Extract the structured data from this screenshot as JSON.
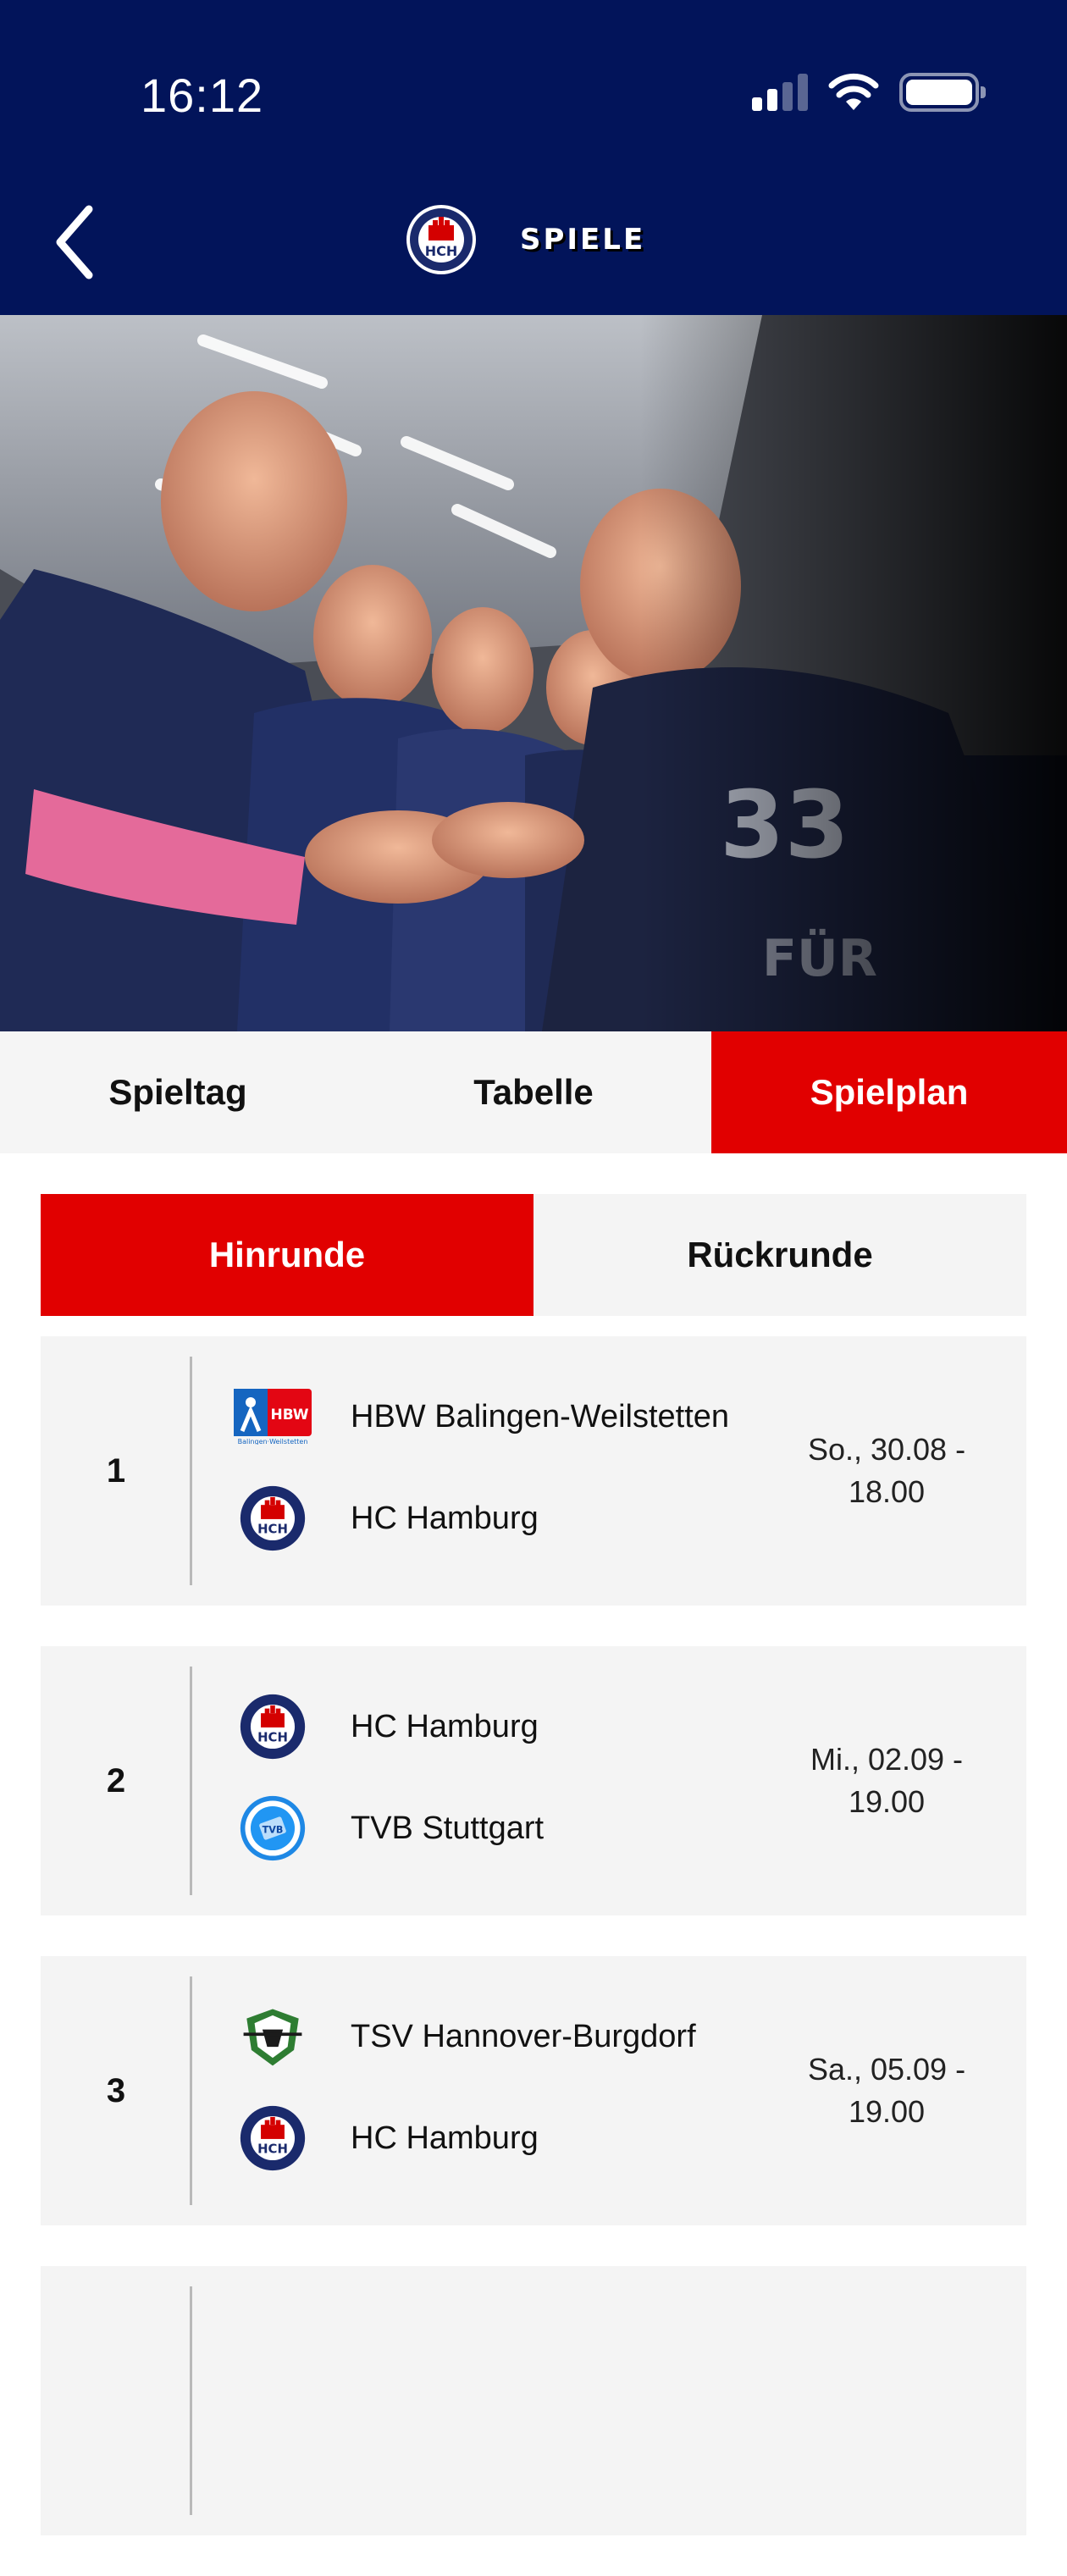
{
  "status_bar": {
    "time": "16:12"
  },
  "header": {
    "title": "SPIELE",
    "back_icon": "chevron-left-icon",
    "logo_text": "HCH"
  },
  "main_tabs": [
    {
      "label": "Spieltag",
      "active": false
    },
    {
      "label": "Tabelle",
      "active": false
    },
    {
      "label": "Spielplan",
      "active": true
    }
  ],
  "sub_tabs": [
    {
      "label": "Hinrunde",
      "active": true
    },
    {
      "label": "Rückrunde",
      "active": false
    }
  ],
  "matches": [
    {
      "day": "1",
      "team1": "HBW Balingen-Weilstetten",
      "team1_logo": "hbw-logo",
      "team2": "HC Hamburg",
      "team2_logo": "hch-logo",
      "date_line1": "So., 30.08 -",
      "date_line2": "18.00"
    },
    {
      "day": "2",
      "team1": "HC Hamburg",
      "team1_logo": "hch-logo",
      "team2": "TVB Stuttgart",
      "team2_logo": "tvb-logo",
      "date_line1": "Mi., 02.09 -",
      "date_line2": "19.00"
    },
    {
      "day": "3",
      "team1": "TSV Hannover-Burgdorf",
      "team1_logo": "recken-logo",
      "team2": "HC Hamburg",
      "team2_logo": "hch-logo",
      "date_line1": "Sa., 05.09 -",
      "date_line2": "19.00"
    }
  ],
  "colors": {
    "header_bg": "#02145a",
    "accent": "#e10000",
    "card_bg": "#f4f4f4"
  }
}
